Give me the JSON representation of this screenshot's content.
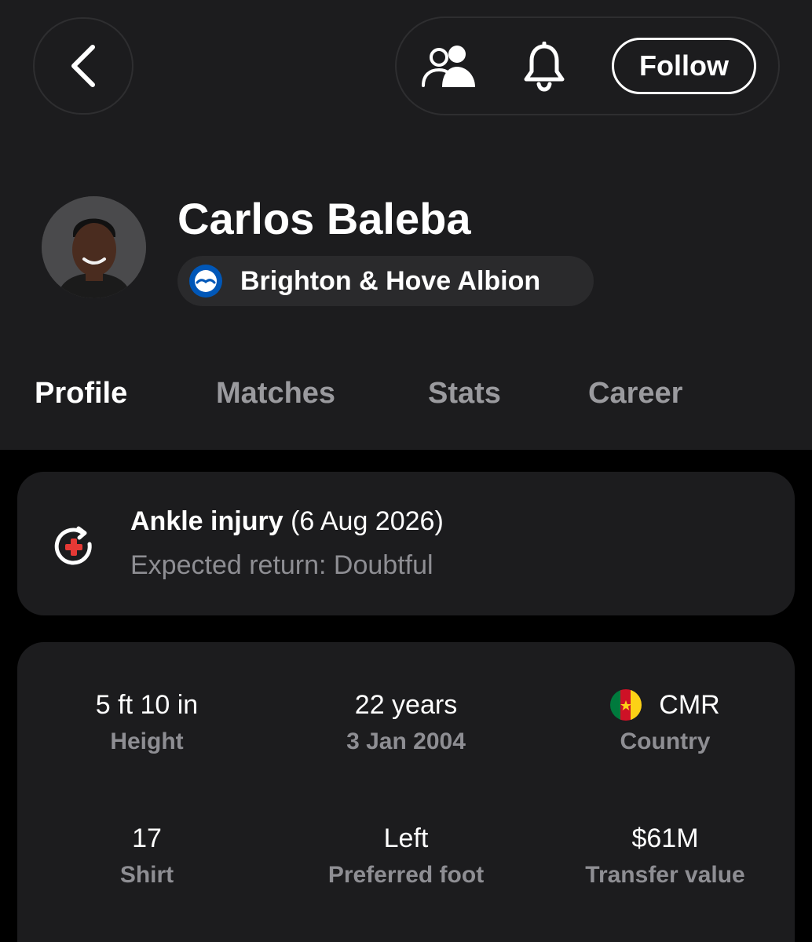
{
  "header": {
    "follow_label": "Follow",
    "icons": {
      "back": "chevron-left-icon",
      "people": "people-icon",
      "bell": "bell-icon"
    }
  },
  "player": {
    "name": "Carlos Baleba",
    "team": "Brighton & Hove Albion"
  },
  "tabs": [
    {
      "label": "Profile",
      "active": true
    },
    {
      "label": "Matches",
      "active": false
    },
    {
      "label": "Stats",
      "active": false
    },
    {
      "label": "Career",
      "active": false
    }
  ],
  "injury": {
    "title": "Ankle injury",
    "date": "(6 Aug 2026)",
    "expected_return": "Expected return: Doubtful",
    "icon": "injury-icon",
    "accent": "#e53935"
  },
  "stats": [
    {
      "value": "5 ft 10 in",
      "label": "Height"
    },
    {
      "value": "22 years",
      "label": "3 Jan 2004"
    },
    {
      "value": "CMR",
      "label": "Country"
    },
    {
      "value": "17",
      "label": "Shirt"
    },
    {
      "value": "Left",
      "label": "Preferred foot"
    },
    {
      "value": "$61M",
      "label": "Transfer value"
    }
  ],
  "colors": {
    "background": "#000000",
    "surface": "#1c1c1e",
    "muted_text": "#8e8e93",
    "team_blue": "#0057b8"
  }
}
